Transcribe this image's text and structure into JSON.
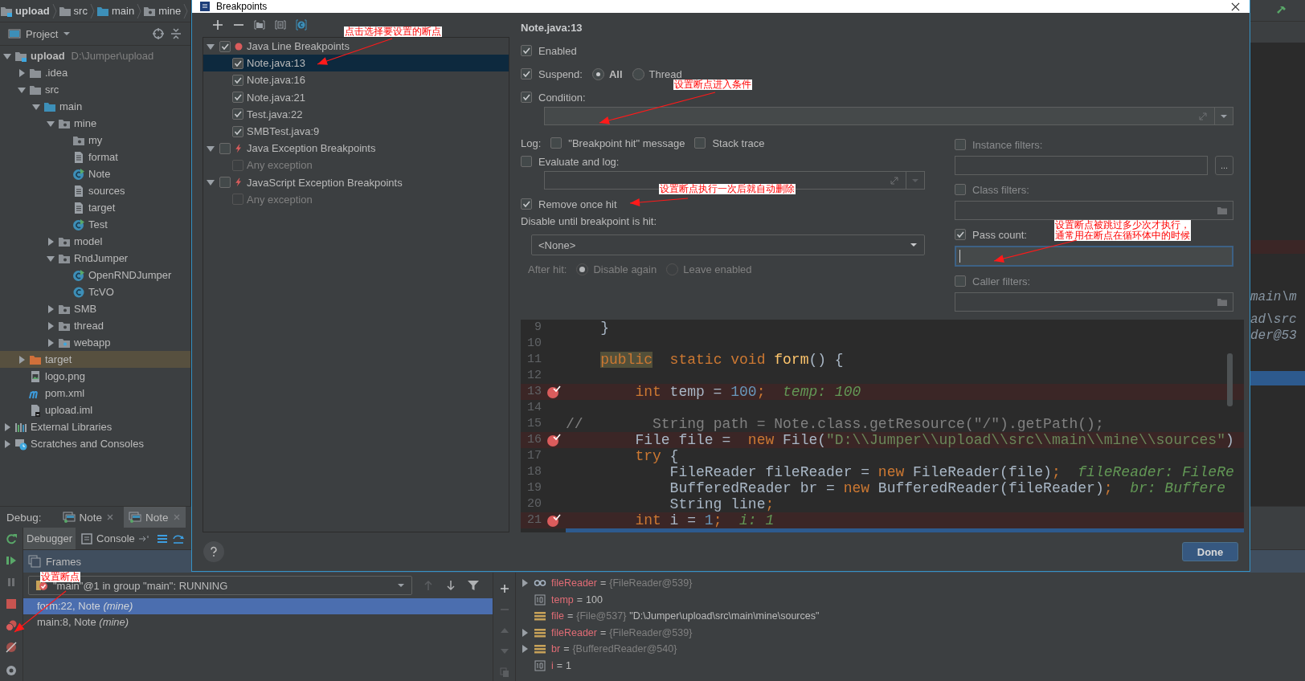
{
  "breadcrumbs": [
    {
      "label": "upload",
      "bold": true,
      "kind": "module"
    },
    {
      "label": "src",
      "bold": false,
      "kind": "folder"
    },
    {
      "label": "main",
      "bold": false,
      "kind": "folder-source"
    },
    {
      "label": "mine",
      "bold": false,
      "kind": "package"
    }
  ],
  "project_panel": {
    "title": "Project",
    "tree": [
      {
        "label": "upload",
        "path": "D:\\Jumper\\upload",
        "bold": true,
        "kind": "module",
        "expanded": true,
        "selected": false,
        "children": [
          {
            "label": ".idea",
            "kind": "folder",
            "expanded": false,
            "selected": false
          },
          {
            "label": "src",
            "kind": "folder",
            "expanded": true,
            "selected": false,
            "children": [
              {
                "label": "main",
                "kind": "folder-source",
                "expanded": true,
                "selected": false,
                "children": [
                  {
                    "label": "mine",
                    "kind": "package",
                    "expanded": true,
                    "selected": false,
                    "children": [
                      {
                        "label": "my",
                        "kind": "package",
                        "selected": false
                      },
                      {
                        "label": "format",
                        "kind": "file",
                        "selected": false
                      },
                      {
                        "label": "Note",
                        "kind": "class-run",
                        "selected": false
                      },
                      {
                        "label": "sources",
                        "kind": "file",
                        "selected": false
                      },
                      {
                        "label": "target",
                        "kind": "file",
                        "selected": false
                      },
                      {
                        "label": "Test",
                        "kind": "class-run",
                        "selected": false
                      }
                    ]
                  },
                  {
                    "label": "model",
                    "kind": "package",
                    "expanded": false,
                    "selected": false
                  },
                  {
                    "label": "RndJumper",
                    "kind": "package",
                    "expanded": true,
                    "selected": false,
                    "children": [
                      {
                        "label": "OpenRNDJumper",
                        "kind": "class-run",
                        "selected": false
                      },
                      {
                        "label": "TcVO",
                        "kind": "class",
                        "selected": false
                      }
                    ]
                  },
                  {
                    "label": "SMB",
                    "kind": "package",
                    "expanded": false,
                    "selected": false
                  },
                  {
                    "label": "thread",
                    "kind": "package",
                    "expanded": false,
                    "selected": false
                  },
                  {
                    "label": "webapp",
                    "kind": "folder-web",
                    "expanded": false,
                    "selected": false
                  }
                ]
              }
            ]
          },
          {
            "label": "target",
            "kind": "folder-excluded",
            "expanded": false,
            "selected": true
          },
          {
            "label": "logo.png",
            "kind": "image",
            "selected": false
          },
          {
            "label": "pom.xml",
            "kind": "maven",
            "selected": false
          },
          {
            "label": "upload.iml",
            "kind": "iml",
            "selected": false
          }
        ]
      },
      {
        "label": "External Libraries",
        "kind": "libraries",
        "expanded": false,
        "selected": false
      },
      {
        "label": "Scratches and Consoles",
        "kind": "scratches",
        "expanded": false,
        "selected": false
      }
    ]
  },
  "editor_fragments": [
    "main\\m",
    "ad\\src",
    "der@53"
  ],
  "dialog": {
    "title": "Breakpoints",
    "tree": [
      {
        "label": "Java Line Breakpoints",
        "kind": "line",
        "checked": true,
        "expanded": true,
        "selected": false,
        "children": [
          {
            "label": "Note.java:13",
            "checked": true,
            "selected": true,
            "disabled": false
          },
          {
            "label": "Note.java:16",
            "checked": true,
            "selected": false,
            "disabled": false
          },
          {
            "label": "Note.java:21",
            "checked": true,
            "selected": false,
            "disabled": false
          },
          {
            "label": "Test.java:22",
            "checked": true,
            "selected": false,
            "disabled": false
          },
          {
            "label": "SMBTest.java:9",
            "checked": true,
            "selected": false,
            "disabled": false
          }
        ]
      },
      {
        "label": "Java Exception Breakpoints",
        "kind": "exception",
        "checked": false,
        "expanded": true,
        "selected": false,
        "children": [
          {
            "label": "Any exception",
            "checked": false,
            "selected": false,
            "disabled": true
          }
        ]
      },
      {
        "label": "JavaScript Exception Breakpoints",
        "kind": "exception",
        "checked": false,
        "expanded": true,
        "selected": false,
        "children": [
          {
            "label": "Any exception",
            "checked": false,
            "selected": false,
            "disabled": true
          }
        ]
      }
    ],
    "heading": "Note.java:13",
    "enabled": {
      "label": "Enabled",
      "checked": true
    },
    "suspend": {
      "label": "Suspend:",
      "checked": true,
      "options": [
        {
          "label": "All",
          "selected": true
        },
        {
          "label": "Thread",
          "selected": false
        }
      ]
    },
    "condition": {
      "label": "Condition:",
      "checked": true
    },
    "log": {
      "label": "Log:",
      "options": [
        {
          "label": "\"Breakpoint hit\" message",
          "checked": false
        },
        {
          "label": "Stack trace",
          "checked": false
        }
      ]
    },
    "evaluate": {
      "label": "Evaluate and log:",
      "checked": false
    },
    "remove_once_hit": {
      "label": "Remove once hit",
      "checked": true
    },
    "disable_until": {
      "label": "Disable until breakpoint is hit:",
      "value": "<None>"
    },
    "after_hit": {
      "label": "After hit:",
      "disabled": true,
      "options": [
        {
          "label": "Disable again",
          "selected": true
        },
        {
          "label": "Leave enabled",
          "selected": false
        }
      ]
    },
    "filters": [
      {
        "kind": "instance",
        "label": "Instance filters:",
        "checked": false,
        "button": "..."
      },
      {
        "kind": "class",
        "label": "Class filters:",
        "checked": false
      },
      {
        "kind": "pass",
        "label": "Pass count:",
        "checked": true
      },
      {
        "kind": "caller",
        "label": "Caller filters:",
        "checked": false
      }
    ],
    "code": [
      {
        "number": "9",
        "breakpoint": false,
        "segments": [
          {
            "kind": "plain",
            "text": "}"
          }
        ]
      },
      {
        "number": "10",
        "breakpoint": false
      },
      {
        "number": "11",
        "breakpoint": false,
        "segments": [
          {
            "kind": "keyword-highlight",
            "text": "public"
          },
          {
            "kind": "keyword",
            "text": "  static void"
          },
          {
            "kind": "method",
            "text": " form"
          },
          {
            "kind": "plain",
            "text": "() {"
          }
        ]
      },
      {
        "number": "12",
        "breakpoint": false
      },
      {
        "number": "13",
        "breakpoint": true,
        "segments": [
          {
            "kind": "keyword",
            "text": "int"
          },
          {
            "kind": "plain",
            "text": " temp = "
          },
          {
            "kind": "number",
            "text": "100"
          },
          {
            "kind": "keyword",
            "text": ";"
          },
          {
            "kind": "hint",
            "text": "  temp: 100"
          }
        ]
      },
      {
        "number": "14",
        "breakpoint": false
      },
      {
        "number": "15",
        "breakpoint": false,
        "segments": [
          {
            "kind": "comment",
            "text": "//        String path = Note.class.getResource(\"/\").getPath();"
          }
        ]
      },
      {
        "number": "16",
        "breakpoint": true,
        "segments": [
          {
            "kind": "plain",
            "text": "File file =  "
          },
          {
            "kind": "keyword",
            "text": "new"
          },
          {
            "kind": "plain",
            "text": " File("
          },
          {
            "kind": "string",
            "text": "\"D:\\\\Jumper\\\\upload\\\\src\\\\main\\\\mine\\\\sources\""
          },
          {
            "kind": "plain",
            "text": ")"
          }
        ]
      },
      {
        "number": "17",
        "breakpoint": false,
        "segments": [
          {
            "kind": "keyword",
            "text": "try"
          },
          {
            "kind": "plain",
            "text": " {"
          }
        ]
      },
      {
        "number": "18",
        "breakpoint": false,
        "segments": [
          {
            "kind": "plain",
            "text": "FileReader fileReader = "
          },
          {
            "kind": "keyword",
            "text": "new"
          },
          {
            "kind": "plain",
            "text": " FileReader(file)"
          },
          {
            "kind": "keyword",
            "text": ";"
          },
          {
            "kind": "hint",
            "text": "  fileReader: FileRe"
          }
        ]
      },
      {
        "number": "19",
        "breakpoint": false,
        "segments": [
          {
            "kind": "plain",
            "text": "BufferedReader br = "
          },
          {
            "kind": "keyword",
            "text": "new"
          },
          {
            "kind": "plain",
            "text": " BufferedReader(fileReader)"
          },
          {
            "kind": "keyword",
            "text": ";"
          },
          {
            "kind": "hint",
            "text": "  br: Buffere"
          }
        ]
      },
      {
        "number": "20",
        "breakpoint": false,
        "segments": [
          {
            "kind": "plain",
            "text": "String line"
          },
          {
            "kind": "keyword",
            "text": ";"
          }
        ]
      },
      {
        "number": "21",
        "breakpoint": true,
        "segments": [
          {
            "kind": "keyword",
            "text": "int"
          },
          {
            "kind": "plain",
            "text": " i = "
          },
          {
            "kind": "number",
            "text": "1"
          },
          {
            "kind": "keyword",
            "text": ";"
          },
          {
            "kind": "hint",
            "text": "  i: 1"
          }
        ]
      }
    ],
    "done": "Done"
  },
  "debug": {
    "label": "Debug:",
    "tabs": [
      {
        "label": "Note",
        "selected": false
      },
      {
        "label": "Note",
        "selected": true
      }
    ],
    "subtabs": [
      {
        "label": "Debugger",
        "selected": true
      },
      {
        "label": "Console",
        "selected": false
      }
    ],
    "frames_title": "Frames",
    "thread": "\"main\"@1 in group \"main\": RUNNING",
    "frames": [
      {
        "text": "form:22, Note *(mine)*",
        "selected": true
      },
      {
        "text": "main:8, Note *(mine)*",
        "selected": false
      }
    ],
    "variables": [
      {
        "kind": "watch",
        "expandable": true,
        "name": "fileReader",
        "separator": "=",
        "ref": "{FileReader@539}"
      },
      {
        "kind": "primitive",
        "expandable": false,
        "name": "temp",
        "separator": "=",
        "value": "100"
      },
      {
        "kind": "field",
        "expandable": false,
        "name": "file",
        "separator": "=",
        "ref": "{File@537}",
        "value": "\"D:\\Jumper\\upload\\src\\main\\mine\\sources\""
      },
      {
        "kind": "field",
        "expandable": true,
        "name": "fileReader",
        "separator": "=",
        "ref": "{FileReader@539}"
      },
      {
        "kind": "field",
        "expandable": true,
        "name": "br",
        "separator": "=",
        "ref": "{BufferedReader@540}"
      },
      {
        "kind": "primitive",
        "expandable": false,
        "name": "i",
        "separator": "=",
        "value": "1"
      }
    ]
  },
  "annotations": [
    {
      "lines": [
        "点击选择要设置的断点"
      ]
    },
    {
      "lines": [
        "设置断点进入条件"
      ]
    },
    {
      "lines": [
        "设置断点执行一次后就自动删除"
      ]
    },
    {
      "lines": [
        "设置断点被跳过多少次才执行，",
        "通常用在断点在循环体中的时候"
      ]
    },
    {
      "lines": [
        "设置断点"
      ]
    }
  ]
}
